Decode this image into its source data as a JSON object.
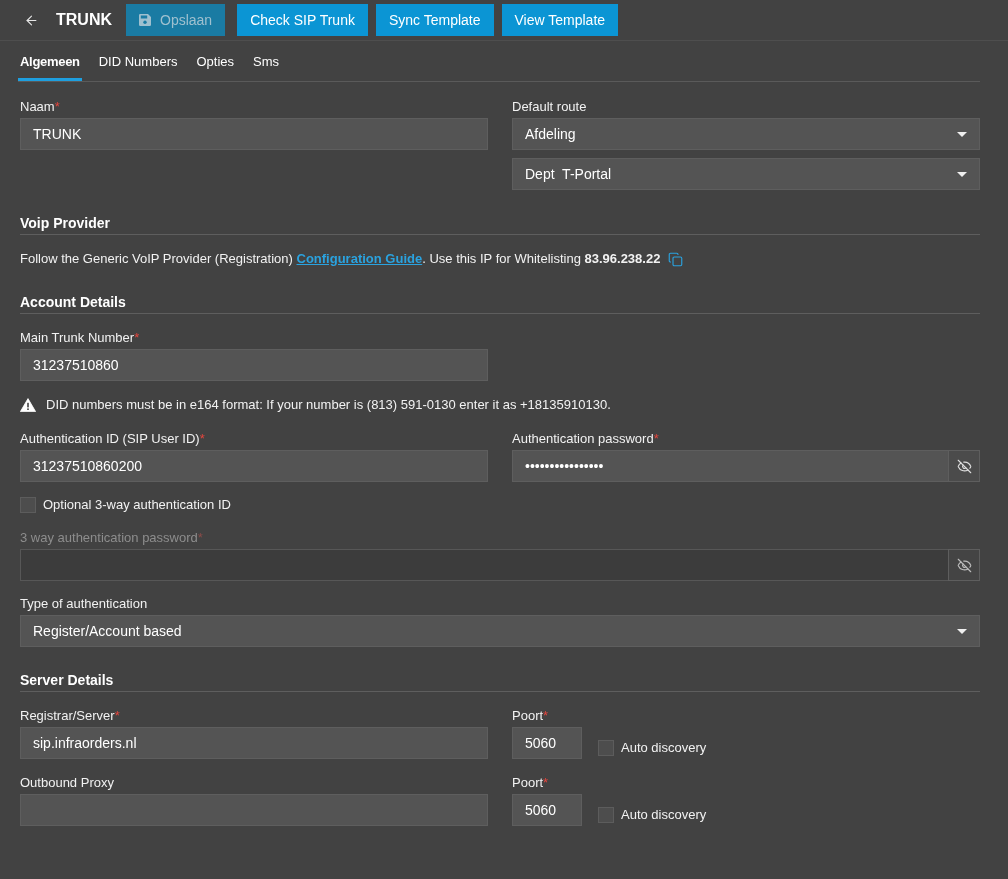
{
  "header": {
    "title": "TRUNK",
    "buttons": [
      {
        "kind": "save",
        "label": "Opslaan",
        "disabled": true
      },
      {
        "kind": "action",
        "label": "Check SIP Trunk",
        "disabled": false
      },
      {
        "kind": "action",
        "label": "Sync Template",
        "disabled": false
      },
      {
        "kind": "action",
        "label": "View Template",
        "disabled": false
      }
    ]
  },
  "tabs": [
    {
      "label": "Algemeen",
      "selected": true
    },
    {
      "label": "DID Numbers",
      "selected": false
    },
    {
      "label": "Opties",
      "selected": false
    },
    {
      "label": "Sms",
      "selected": false
    }
  ],
  "general": {
    "name": {
      "label": "Naam",
      "required_mark": "*",
      "value": "TRUNK"
    },
    "default_route": {
      "label": "Default route",
      "selects": [
        {
          "value": "Afdeling"
        },
        {
          "value": "Dept  T-Portal"
        }
      ]
    }
  },
  "voip_provider": {
    "heading": "Voip Provider",
    "text_before": "Follow the Generic VoIP Provider (Registration)",
    "link": "Configuration Guide",
    "text_after": ". Use this IP for Whitelisting **83.96.238.22**"
  },
  "account_details": {
    "heading": "Account Details",
    "main_trunk_number": {
      "label": "Main Trunk Number",
      "required_mark": "*",
      "value": "31237510860"
    },
    "warning": "DID numbers must be in e164 format: If your number is (813) 591-0130 enter it as +18135910130.",
    "auth_id": {
      "label": "Authentication ID (SIP User ID)",
      "required_mark": "*",
      "value": "31237510860200"
    },
    "auth_password": {
      "label": "Authentication password",
      "required_mark": "*",
      "value": "••••••••••••••••",
      "disabled": false
    },
    "optional_auth_id": {
      "label": "Optional 3-way authentication ID",
      "checked": false
    },
    "three_way_password": {
      "label": "3 way authentication password",
      "required_mark": "*",
      "disabled": true
    },
    "auth_type": {
      "label": "Type of authentication",
      "value": "Register/Account based"
    }
  },
  "server_details": {
    "heading": "Server Details",
    "rows": [
      {
        "server": {
          "label": "Registrar/Server",
          "required_mark": "*",
          "value": "sip.infraorders.nl"
        },
        "port": {
          "label": "Poort",
          "required_mark": "*",
          "value": "5060"
        },
        "auto_discovery": {
          "label": "Auto discovery",
          "checked": false
        }
      },
      {
        "server": {
          "label": "Outbound Proxy"
        },
        "port": {
          "label": "Poort",
          "required_mark": "*",
          "value": "5060"
        },
        "auto_discovery": {
          "label": "Auto discovery",
          "checked": false
        }
      }
    ]
  }
}
